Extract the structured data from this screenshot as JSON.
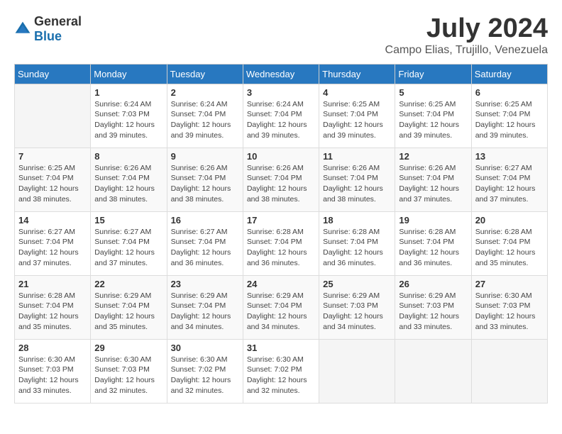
{
  "header": {
    "logo_general": "General",
    "logo_blue": "Blue",
    "month": "July 2024",
    "location": "Campo Elias, Trujillo, Venezuela"
  },
  "weekdays": [
    "Sunday",
    "Monday",
    "Tuesday",
    "Wednesday",
    "Thursday",
    "Friday",
    "Saturday"
  ],
  "weeks": [
    [
      {
        "day": "",
        "info": ""
      },
      {
        "day": "1",
        "info": "Sunrise: 6:24 AM\nSunset: 7:03 PM\nDaylight: 12 hours\nand 39 minutes."
      },
      {
        "day": "2",
        "info": "Sunrise: 6:24 AM\nSunset: 7:04 PM\nDaylight: 12 hours\nand 39 minutes."
      },
      {
        "day": "3",
        "info": "Sunrise: 6:24 AM\nSunset: 7:04 PM\nDaylight: 12 hours\nand 39 minutes."
      },
      {
        "day": "4",
        "info": "Sunrise: 6:25 AM\nSunset: 7:04 PM\nDaylight: 12 hours\nand 39 minutes."
      },
      {
        "day": "5",
        "info": "Sunrise: 6:25 AM\nSunset: 7:04 PM\nDaylight: 12 hours\nand 39 minutes."
      },
      {
        "day": "6",
        "info": "Sunrise: 6:25 AM\nSunset: 7:04 PM\nDaylight: 12 hours\nand 39 minutes."
      }
    ],
    [
      {
        "day": "7",
        "info": "Sunrise: 6:25 AM\nSunset: 7:04 PM\nDaylight: 12 hours\nand 38 minutes."
      },
      {
        "day": "8",
        "info": "Sunrise: 6:26 AM\nSunset: 7:04 PM\nDaylight: 12 hours\nand 38 minutes."
      },
      {
        "day": "9",
        "info": "Sunrise: 6:26 AM\nSunset: 7:04 PM\nDaylight: 12 hours\nand 38 minutes."
      },
      {
        "day": "10",
        "info": "Sunrise: 6:26 AM\nSunset: 7:04 PM\nDaylight: 12 hours\nand 38 minutes."
      },
      {
        "day": "11",
        "info": "Sunrise: 6:26 AM\nSunset: 7:04 PM\nDaylight: 12 hours\nand 38 minutes."
      },
      {
        "day": "12",
        "info": "Sunrise: 6:26 AM\nSunset: 7:04 PM\nDaylight: 12 hours\nand 37 minutes."
      },
      {
        "day": "13",
        "info": "Sunrise: 6:27 AM\nSunset: 7:04 PM\nDaylight: 12 hours\nand 37 minutes."
      }
    ],
    [
      {
        "day": "14",
        "info": "Sunrise: 6:27 AM\nSunset: 7:04 PM\nDaylight: 12 hours\nand 37 minutes."
      },
      {
        "day": "15",
        "info": "Sunrise: 6:27 AM\nSunset: 7:04 PM\nDaylight: 12 hours\nand 37 minutes."
      },
      {
        "day": "16",
        "info": "Sunrise: 6:27 AM\nSunset: 7:04 PM\nDaylight: 12 hours\nand 36 minutes."
      },
      {
        "day": "17",
        "info": "Sunrise: 6:28 AM\nSunset: 7:04 PM\nDaylight: 12 hours\nand 36 minutes."
      },
      {
        "day": "18",
        "info": "Sunrise: 6:28 AM\nSunset: 7:04 PM\nDaylight: 12 hours\nand 36 minutes."
      },
      {
        "day": "19",
        "info": "Sunrise: 6:28 AM\nSunset: 7:04 PM\nDaylight: 12 hours\nand 36 minutes."
      },
      {
        "day": "20",
        "info": "Sunrise: 6:28 AM\nSunset: 7:04 PM\nDaylight: 12 hours\nand 35 minutes."
      }
    ],
    [
      {
        "day": "21",
        "info": "Sunrise: 6:28 AM\nSunset: 7:04 PM\nDaylight: 12 hours\nand 35 minutes."
      },
      {
        "day": "22",
        "info": "Sunrise: 6:29 AM\nSunset: 7:04 PM\nDaylight: 12 hours\nand 35 minutes."
      },
      {
        "day": "23",
        "info": "Sunrise: 6:29 AM\nSunset: 7:04 PM\nDaylight: 12 hours\nand 34 minutes."
      },
      {
        "day": "24",
        "info": "Sunrise: 6:29 AM\nSunset: 7:04 PM\nDaylight: 12 hours\nand 34 minutes."
      },
      {
        "day": "25",
        "info": "Sunrise: 6:29 AM\nSunset: 7:03 PM\nDaylight: 12 hours\nand 34 minutes."
      },
      {
        "day": "26",
        "info": "Sunrise: 6:29 AM\nSunset: 7:03 PM\nDaylight: 12 hours\nand 33 minutes."
      },
      {
        "day": "27",
        "info": "Sunrise: 6:30 AM\nSunset: 7:03 PM\nDaylight: 12 hours\nand 33 minutes."
      }
    ],
    [
      {
        "day": "28",
        "info": "Sunrise: 6:30 AM\nSunset: 7:03 PM\nDaylight: 12 hours\nand 33 minutes."
      },
      {
        "day": "29",
        "info": "Sunrise: 6:30 AM\nSunset: 7:03 PM\nDaylight: 12 hours\nand 32 minutes."
      },
      {
        "day": "30",
        "info": "Sunrise: 6:30 AM\nSunset: 7:02 PM\nDaylight: 12 hours\nand 32 minutes."
      },
      {
        "day": "31",
        "info": "Sunrise: 6:30 AM\nSunset: 7:02 PM\nDaylight: 12 hours\nand 32 minutes."
      },
      {
        "day": "",
        "info": ""
      },
      {
        "day": "",
        "info": ""
      },
      {
        "day": "",
        "info": ""
      }
    ]
  ]
}
